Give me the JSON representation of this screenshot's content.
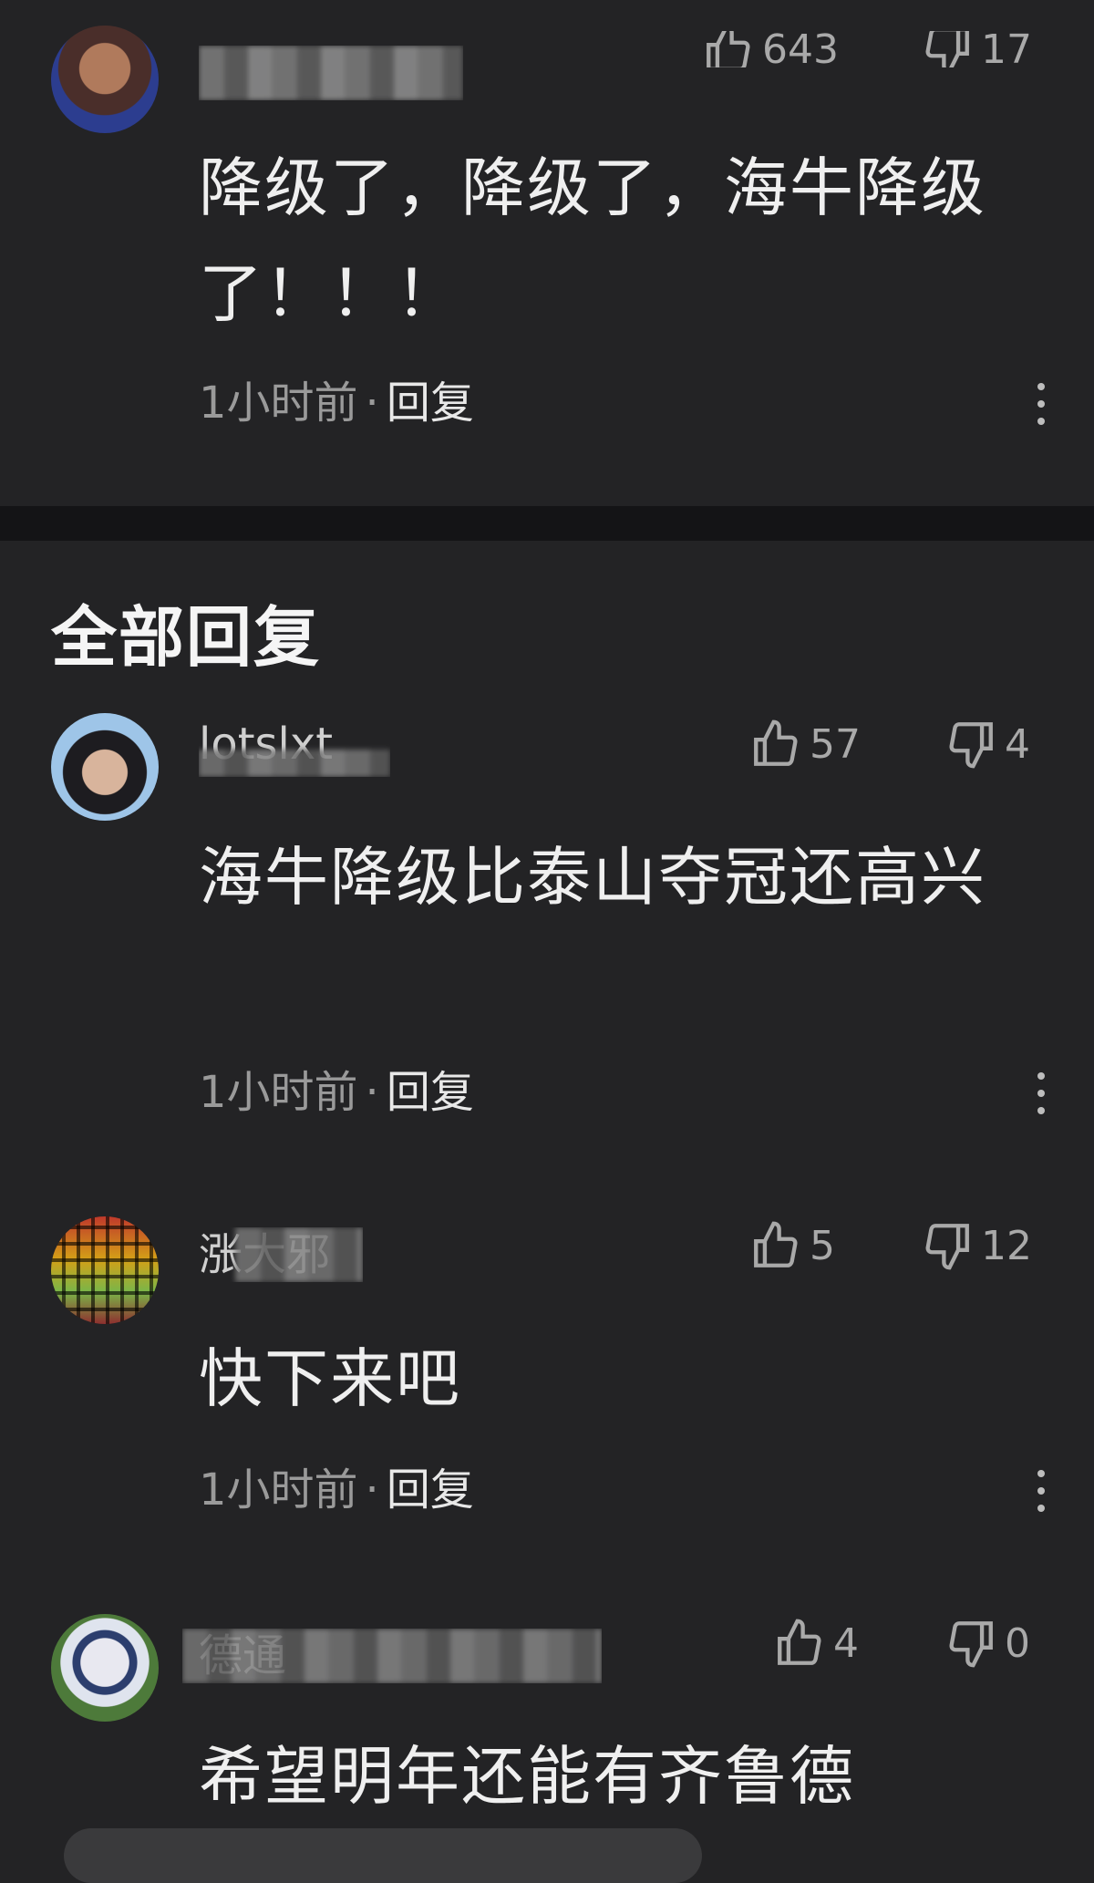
{
  "colors": {
    "background": "#232325",
    "divider": "#141416",
    "meta": "#9a9a9a",
    "text": "#efefef"
  },
  "top_comment": {
    "likes": "643",
    "dislikes": "17",
    "content": "降级了，降级了，海牛降级了！！！",
    "time": "1小时前",
    "reply_label": "回复"
  },
  "section_title": "全部回复",
  "replies": [
    {
      "username": "lotslxt",
      "likes": "57",
      "dislikes": "4",
      "content": "海牛降级比泰山夺冠还高兴",
      "time": "1小时前",
      "reply_label": "回复"
    },
    {
      "username": "涨大邪",
      "likes": "5",
      "dislikes": "12",
      "content": "快下来吧",
      "time": "1小时前",
      "reply_label": "回复"
    },
    {
      "username": "德通",
      "likes": "4",
      "dislikes": "0",
      "content": "希望明年还能有齐鲁德",
      "time": "",
      "reply_label": ""
    }
  ],
  "icons": {
    "like": "thumbs-up-icon",
    "dislike": "thumbs-down-icon",
    "more": "more-vertical-icon"
  }
}
